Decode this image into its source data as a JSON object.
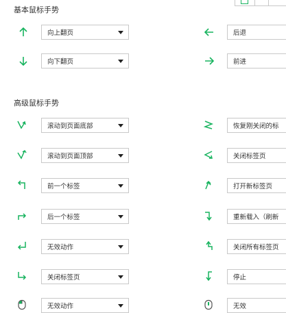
{
  "colors": {
    "accent": "#17b35e",
    "border": "#c8c8c8",
    "text": "#333333"
  },
  "basic": {
    "title": "基本鼠标手势",
    "rows": [
      {
        "left": {
          "icon": "arrow-up-icon",
          "value": "向上翻页"
        },
        "right": {
          "icon": "arrow-left-icon",
          "value": "后退"
        }
      },
      {
        "left": {
          "icon": "arrow-down-icon",
          "value": "向下翻页"
        },
        "right": {
          "icon": "arrow-right-icon",
          "value": "前进"
        }
      }
    ]
  },
  "advanced": {
    "title": "高级鼠标手势",
    "rows": [
      {
        "left": {
          "icon": "gesture-down-up-icon",
          "value": "滚动到页面底部"
        },
        "right": {
          "icon": "gesture-right-left-right-icon",
          "value": "恢复刚关闭的标"
        }
      },
      {
        "left": {
          "icon": "gesture-up-down-icon",
          "value": "滚动到页面顶部"
        },
        "right": {
          "icon": "gesture-left-right-left-icon",
          "value": "关闭标签页"
        }
      },
      {
        "left": {
          "icon": "gesture-up-left-icon",
          "value": "前一个标签"
        },
        "right": {
          "icon": "gesture-down-up-alt-icon",
          "value": "打开新标签页"
        }
      },
      {
        "left": {
          "icon": "gesture-right-icon",
          "value": "后一个标签"
        },
        "right": {
          "icon": "gesture-right-down-icon",
          "value": "重新载入（刷新"
        }
      },
      {
        "left": {
          "icon": "gesture-down-left-icon",
          "value": "无效动作"
        },
        "right": {
          "icon": "gesture-up-right-icon",
          "value": "关闭所有标签页"
        }
      },
      {
        "left": {
          "icon": "gesture-down-right-icon",
          "value": "关闭标签页"
        },
        "right": {
          "icon": "gesture-down-left-alt-icon",
          "value": "停止"
        }
      },
      {
        "left": {
          "icon": "mouse-left-button-icon",
          "value": "无效动作"
        },
        "right": {
          "icon": "mouse-wheel-icon",
          "value": "无效"
        }
      }
    ]
  }
}
